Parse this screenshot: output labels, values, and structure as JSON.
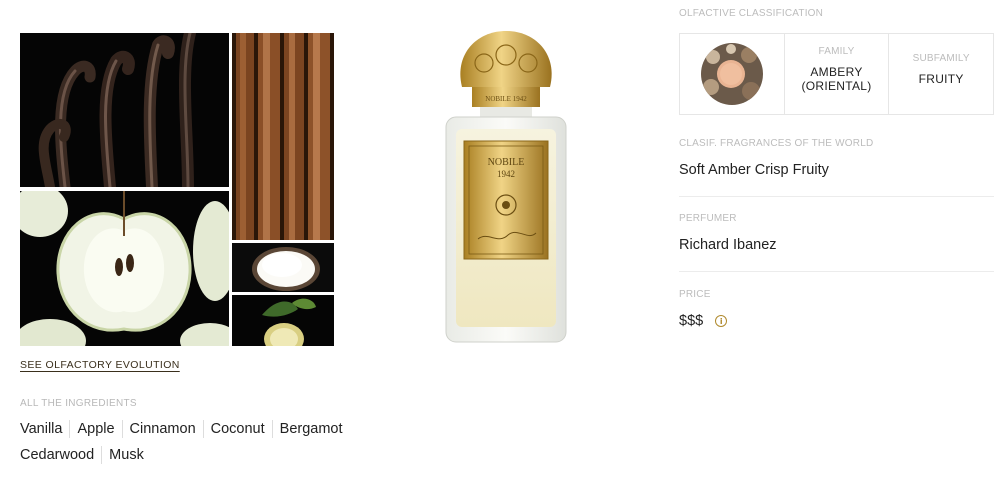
{
  "ingredients_section": {
    "evolution_link": "SEE OLFACTORY EVOLUTION",
    "title": "ALL THE INGREDIENTS",
    "items": [
      "Vanilla",
      "Apple",
      "Cinnamon",
      "Coconut",
      "Bergamot",
      "Cedarwood",
      "Musk"
    ]
  },
  "product": {
    "bottle_cap_text": "NOBILE 1942",
    "label_brand": "NOBILE",
    "label_year": "1942"
  },
  "classification": {
    "title": "OLFACTIVE CLASSIFICATION",
    "family_label": "FAMILY",
    "family_value_line1": "AMBERY",
    "family_value_line2": "(ORIENTAL)",
    "subfamily_label": "SUBFAMILY",
    "subfamily_value": "FRUITY"
  },
  "fragrances_of_world": {
    "label": "CLASIF. FRAGRANCES OF THE WORLD",
    "value": "Soft Amber Crisp Fruity"
  },
  "perfumer": {
    "label": "PERFUMER",
    "value": "Richard Ibanez"
  },
  "price": {
    "label": "PRICE",
    "value": "$$$",
    "info_icon": "info-icon"
  },
  "colors": {
    "gold": "#c9a23a",
    "link": "#3a2f1c",
    "muted_label": "#bcbcbc",
    "border": "#e6e6e6"
  }
}
